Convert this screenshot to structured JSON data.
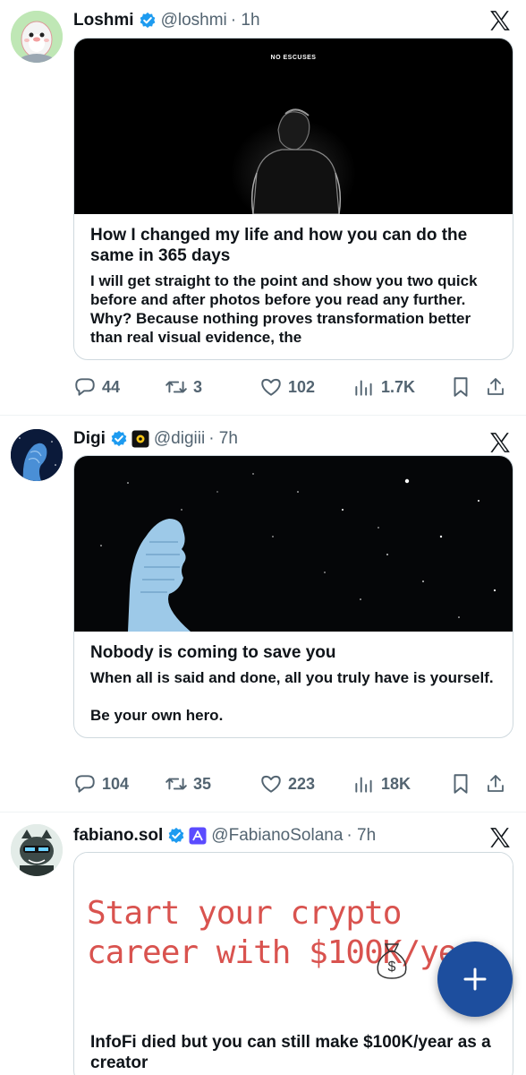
{
  "posts": [
    {
      "author_name": "Loshmi",
      "handle": "@loshmi",
      "time": "· 1h",
      "image_caption": "NO ESCUSES",
      "article_title": "How I changed my life and how you can do the same in 365 days",
      "article_body": "I will get straight to the point and show you two quick before and after photos before you read any further. Why? Because nothing proves transformation better than real visual evidence, the",
      "replies": "44",
      "reposts": "3",
      "likes": "102",
      "views": "1.7K"
    },
    {
      "author_name": "Digi",
      "handle": "@digiii",
      "time": "· 7h",
      "article_title": "Nobody is coming to save you",
      "article_body": "When all is said and done, all you truly have is yourself.\n\nBe your own hero.",
      "replies": "104",
      "reposts": "35",
      "likes": "223",
      "views": "18K"
    },
    {
      "author_name": "fabiano.sol",
      "handle": "@FabianoSolana",
      "time": "· 7h",
      "image_headline": "Start your crypto career with $100K/year",
      "money_bag_symbol": "$",
      "article_title": "InfoFi died but you can still make $100K/year as a creator"
    }
  ],
  "colors": {
    "verified": "#1d9bf0",
    "fab": "#1d4e9e",
    "muted": "#536471",
    "headline_red": "#d9534f"
  },
  "icons": [
    "verified-badge-icon",
    "x-logo-icon",
    "reply-icon",
    "repost-icon",
    "like-icon",
    "views-icon",
    "bookmark-icon",
    "share-icon",
    "plus-icon"
  ],
  "fab_label": "+"
}
